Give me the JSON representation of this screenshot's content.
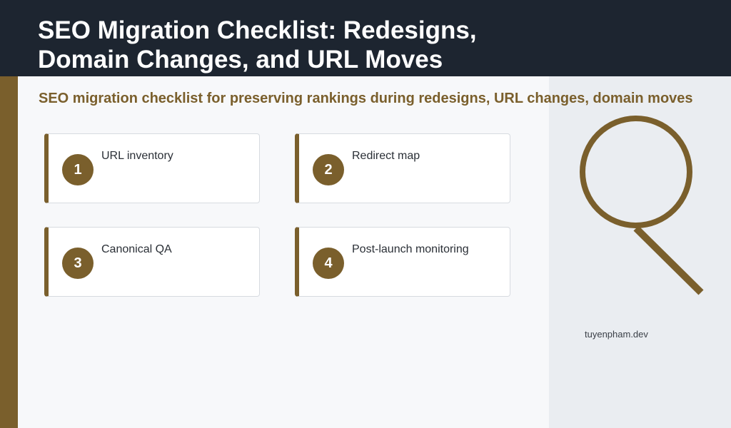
{
  "header": {
    "title": "SEO Migration Checklist: Redesigns, Domain Changes, and URL Moves"
  },
  "subtitle": "SEO migration checklist for preserving rankings during redesigns, URL changes, domain moves",
  "steps": [
    {
      "number": "1",
      "label": "URL inventory"
    },
    {
      "number": "2",
      "label": "Redirect map"
    },
    {
      "number": "3",
      "label": "Canonical QA"
    },
    {
      "number": "4",
      "label": "Post-launch monitoring"
    }
  ],
  "illustration": {
    "icon": "magnifying-glass-icon"
  },
  "site": "tuyenpham.dev",
  "colors": {
    "header_bg": "#1d2530",
    "accent": "#7a5f2c",
    "page_bg": "#f7f8fa",
    "panel_bg": "#eaedf1"
  }
}
